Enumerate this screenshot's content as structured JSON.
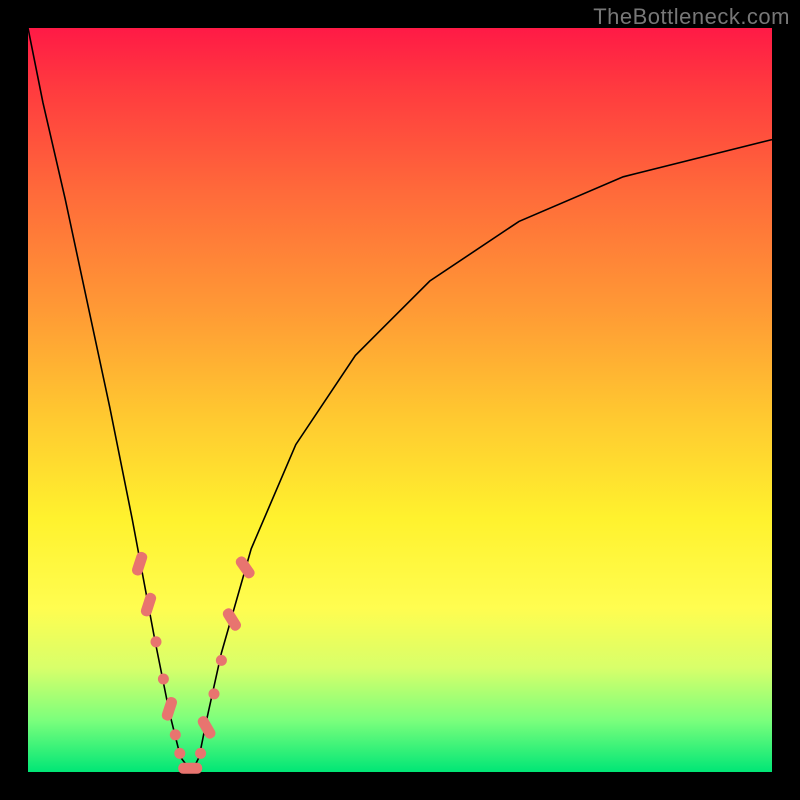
{
  "watermark": "TheBottleneck.com",
  "chart_data": {
    "type": "line",
    "title": "",
    "xlabel": "",
    "ylabel": "",
    "xlim": [
      0,
      100
    ],
    "ylim": [
      0,
      100
    ],
    "grid": false,
    "legend": false,
    "series": [
      {
        "name": "bottleneck-curve",
        "x": [
          0,
          2,
          5,
          8,
          11,
          14,
          17,
          19,
          20.5,
          22,
          23,
          24,
          26,
          30,
          36,
          44,
          54,
          66,
          80,
          100
        ],
        "y": [
          100,
          90,
          77,
          63,
          49,
          34,
          18,
          8,
          2,
          0,
          2,
          7,
          16,
          30,
          44,
          56,
          66,
          74,
          80,
          85
        ]
      }
    ],
    "markers": [
      {
        "shape": "pill",
        "x": 15.0,
        "y": 28.0,
        "angle": -72
      },
      {
        "shape": "pill",
        "x": 16.2,
        "y": 22.5,
        "angle": -72
      },
      {
        "shape": "dot",
        "x": 17.2,
        "y": 17.5
      },
      {
        "shape": "dot",
        "x": 18.2,
        "y": 12.5
      },
      {
        "shape": "pill",
        "x": 19.0,
        "y": 8.5,
        "angle": -72
      },
      {
        "shape": "dot",
        "x": 19.8,
        "y": 5.0
      },
      {
        "shape": "dot",
        "x": 20.4,
        "y": 2.5
      },
      {
        "shape": "pill",
        "x": 21.8,
        "y": 0.5,
        "angle": 0
      },
      {
        "shape": "dot",
        "x": 23.2,
        "y": 2.5
      },
      {
        "shape": "pill",
        "x": 24.0,
        "y": 6.0,
        "angle": 60
      },
      {
        "shape": "dot",
        "x": 25.0,
        "y": 10.5
      },
      {
        "shape": "dot",
        "x": 26.0,
        "y": 15.0
      },
      {
        "shape": "pill",
        "x": 27.4,
        "y": 20.5,
        "angle": 58
      },
      {
        "shape": "pill",
        "x": 29.2,
        "y": 27.5,
        "angle": 55
      }
    ],
    "gradient_stops": [
      {
        "pos": 0,
        "color": "#ff1a46"
      },
      {
        "pos": 22,
        "color": "#ff6a3a"
      },
      {
        "pos": 52,
        "color": "#ffc830"
      },
      {
        "pos": 78,
        "color": "#fffd50"
      },
      {
        "pos": 100,
        "color": "#00e676"
      }
    ]
  }
}
